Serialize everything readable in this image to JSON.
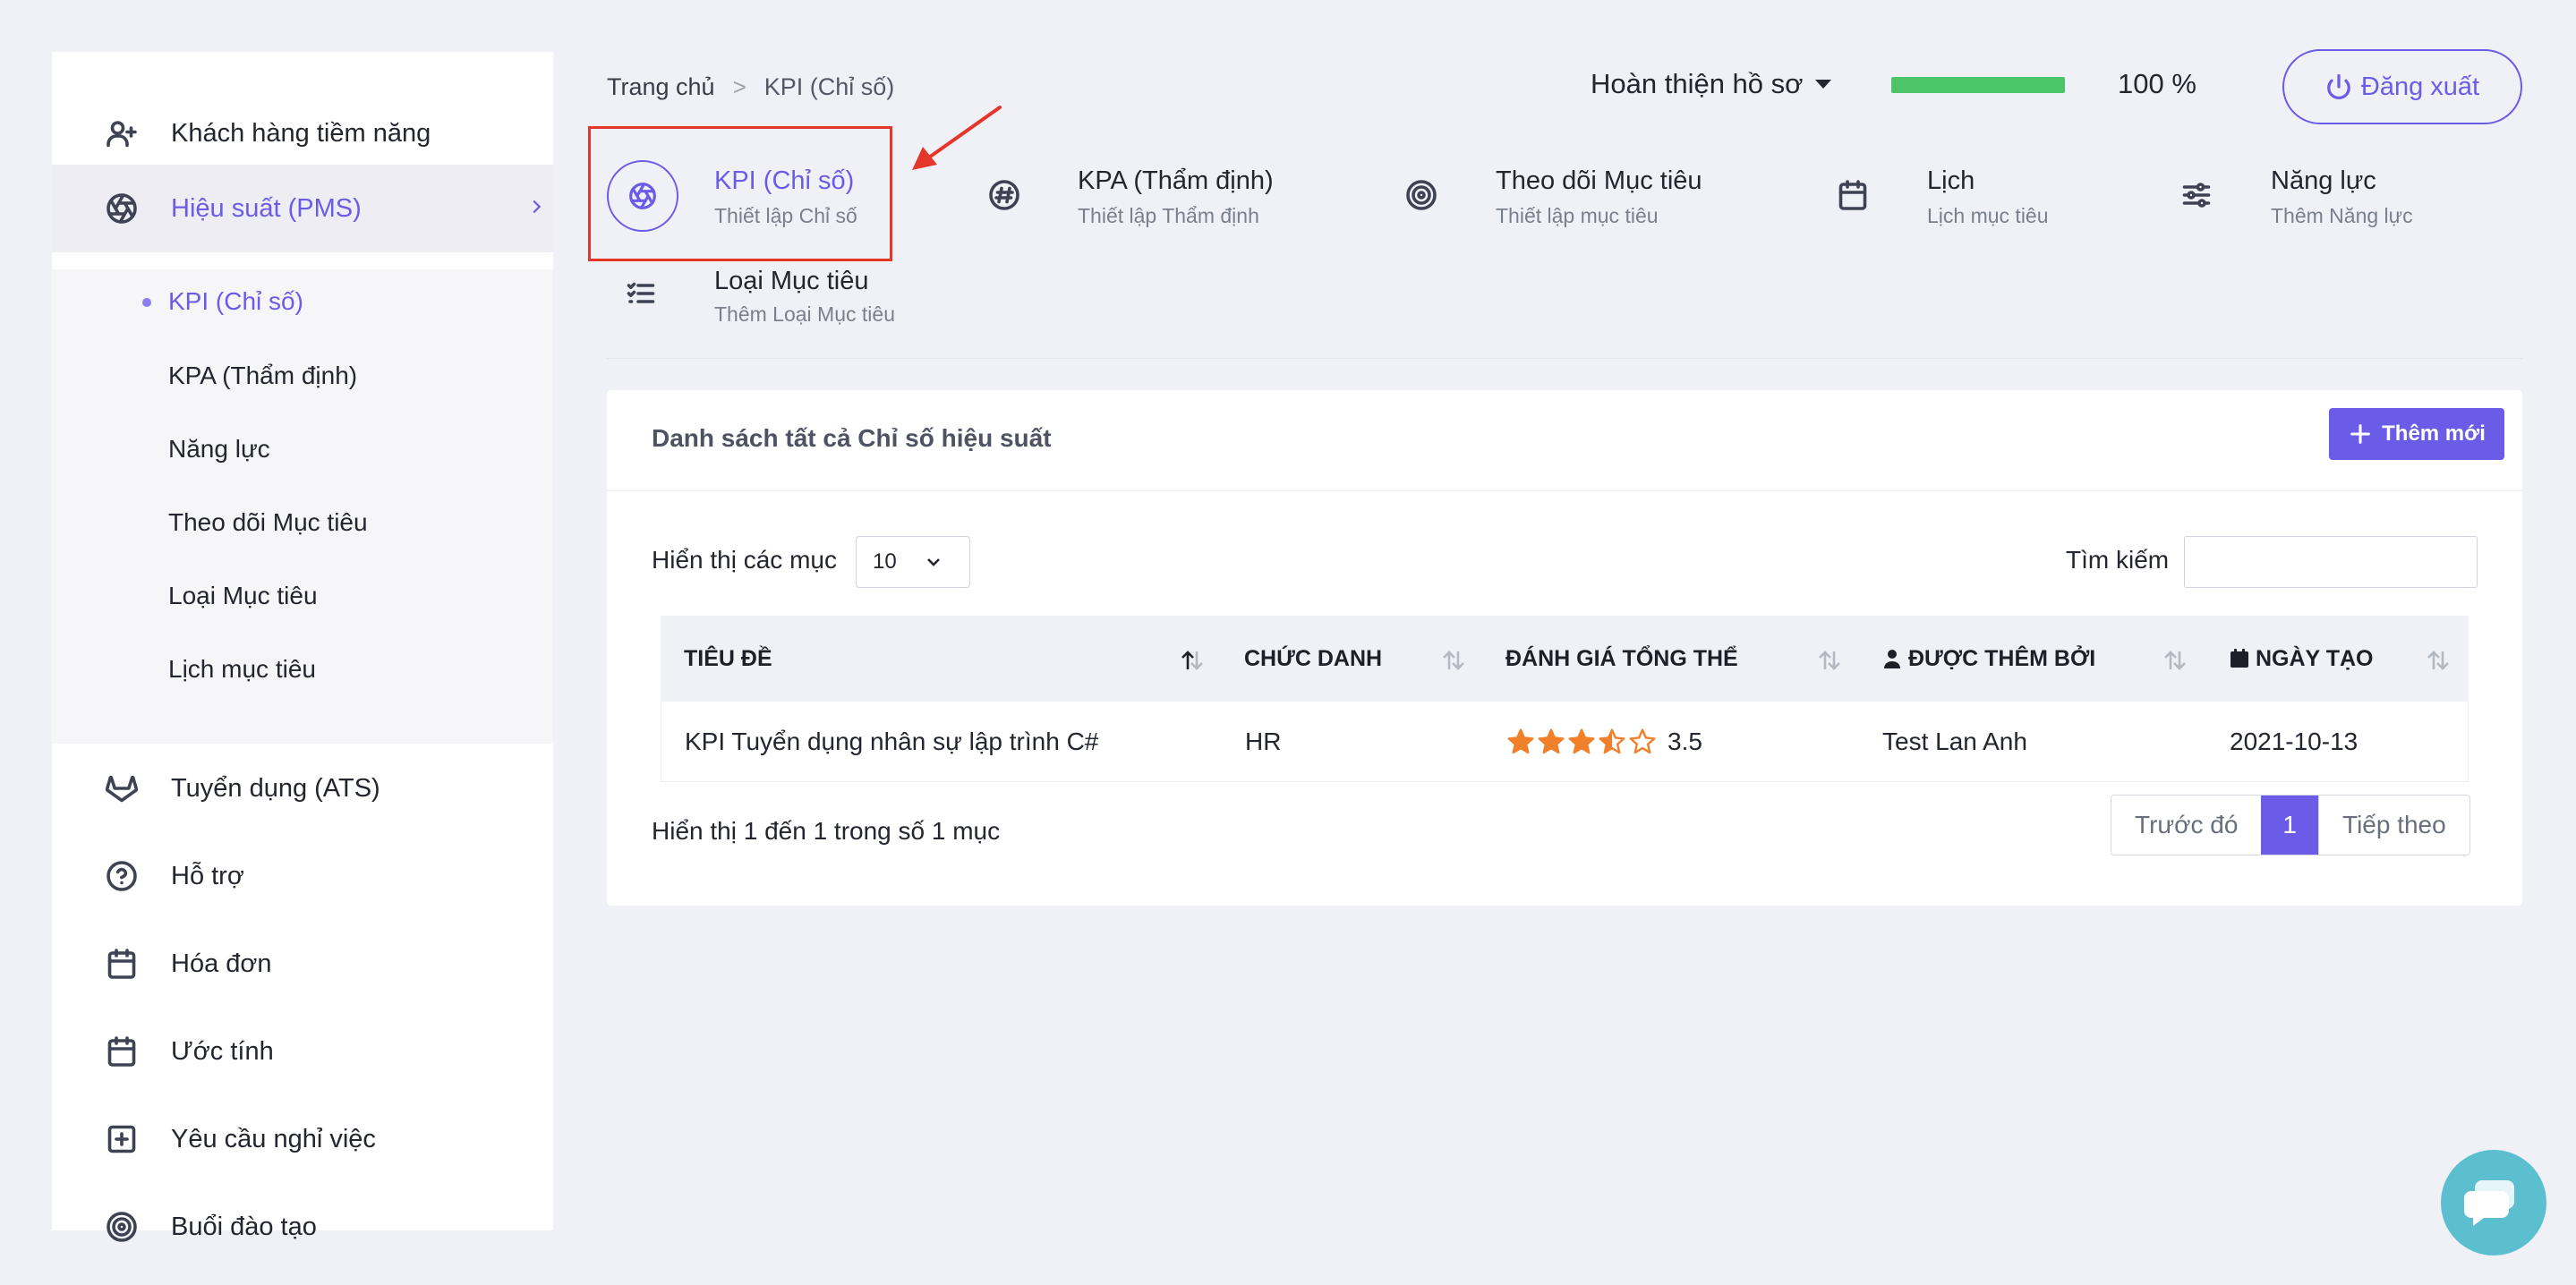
{
  "sidebar": {
    "items": [
      {
        "label": "Khách hàng tiềm năng",
        "icon": "user-plus-icon"
      },
      {
        "label": "Hiệu suất (PMS)",
        "icon": "aperture-icon",
        "active": true
      },
      {
        "label": "Tuyển dụng (ATS)",
        "icon": "gitlab-icon"
      },
      {
        "label": "Hỗ trợ",
        "icon": "help-circle-icon"
      },
      {
        "label": "Hóa đơn",
        "icon": "calendar-icon"
      },
      {
        "label": "Ước tính",
        "icon": "calendar-icon"
      },
      {
        "label": "Yêu cầu nghỉ việc",
        "icon": "plus-square-icon"
      },
      {
        "label": "Buổi đào tạo",
        "icon": "target-icon"
      }
    ],
    "sub_items": [
      {
        "label": "KPI (Chỉ số)",
        "active": true
      },
      {
        "label": "KPA (Thẩm định)"
      },
      {
        "label": "Năng lực"
      },
      {
        "label": "Theo dõi Mục tiêu"
      },
      {
        "label": "Loại Mục tiêu"
      },
      {
        "label": "Lịch mục tiêu"
      }
    ]
  },
  "header": {
    "breadcrumb": {
      "home": "Trang chủ",
      "separator": ">",
      "current": "KPI (Chỉ số)"
    },
    "profile_menu": "Hoàn thiện hồ sơ",
    "progress_percent": 100,
    "progress_label": "100 %",
    "logout_label": "Đăng xuất"
  },
  "tabs": [
    {
      "title": "KPI (Chỉ số)",
      "subtitle": "Thiết lập Chỉ số",
      "icon": "aperture-icon",
      "active": true
    },
    {
      "title": "KPA (Thẩm định)",
      "subtitle": "Thiết lập Thẩm định",
      "icon": "hash-icon"
    },
    {
      "title": "Theo dõi Mục tiêu",
      "subtitle": "Thiết lập mục tiêu",
      "icon": "target-icon"
    },
    {
      "title": "Lịch",
      "subtitle": "Lịch mục tiêu",
      "icon": "calendar-icon"
    },
    {
      "title": "Năng lực",
      "subtitle": "Thêm Năng lực",
      "icon": "sliders-icon"
    },
    {
      "title": "Loại Mục tiêu",
      "subtitle": "Thêm Loại Mục tiêu",
      "icon": "list-check-icon"
    }
  ],
  "card": {
    "title": "Danh sách tất cả Chỉ số hiệu suất",
    "add_button": "Thêm mới",
    "length_label": "Hiển thị các mục",
    "length_value": "10",
    "search_label": "Tìm kiếm",
    "search_value": "",
    "columns": [
      "TIÊU ĐỀ",
      "CHỨC DANH",
      "ĐÁNH GIÁ TỔNG THỂ",
      "ĐƯỢC THÊM BỞI",
      "NGÀY TẠO"
    ],
    "rows": [
      {
        "title": "KPI Tuyển dụng nhân sự lập trình C#",
        "designation": "HR",
        "rating": 3.5,
        "rating_label": "3.5",
        "added_by": "Test Lan Anh",
        "created": "2021-10-13"
      }
    ],
    "info": "Hiển thị 1 đến 1 trong số 1 mục",
    "pager": {
      "prev": "Trước đó",
      "current": "1",
      "next": "Tiếp theo"
    }
  },
  "colors": {
    "accent": "#6b5ce7",
    "progress": "#4cc568",
    "star": "#f0802a",
    "highlight": "#e5362c",
    "chat": "#5bbfcf"
  }
}
